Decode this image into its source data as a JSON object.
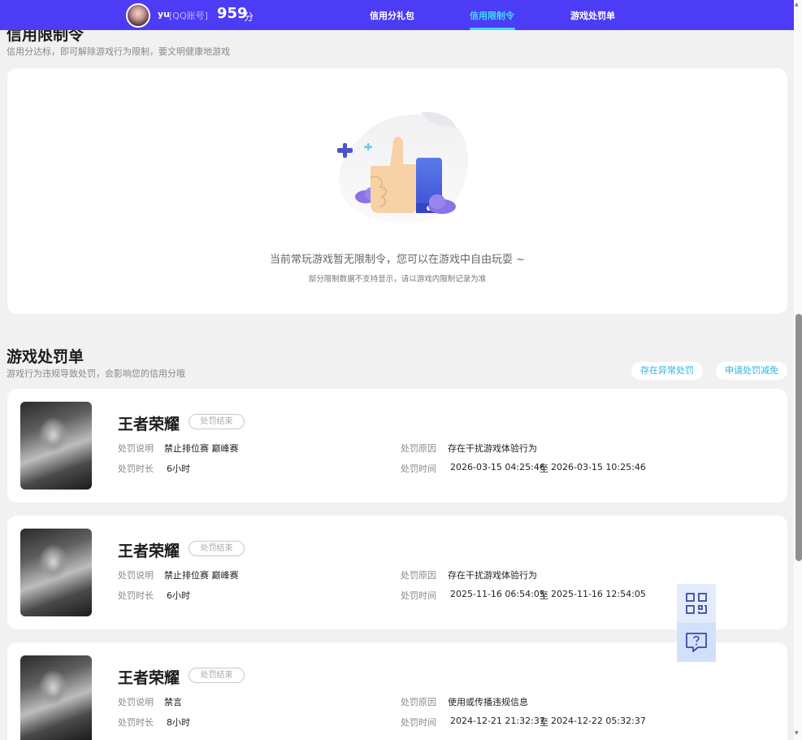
{
  "header": {
    "nickname": "yu",
    "account_type": "[QQ账号]",
    "score": "959",
    "score_unit": "分",
    "nav": [
      {
        "label": "信用分礼包",
        "active": false
      },
      {
        "label": "信用限制令",
        "active": true
      },
      {
        "label": "游戏处罚单",
        "active": false
      }
    ],
    "active_color": "#42d7ff",
    "bar_color": "#4c3cf5"
  },
  "restriction": {
    "title": "信用限制令",
    "desc": "信用分达标，即可解除游戏行为限制，要文明健康地游戏",
    "empty_main": "当前常玩游戏暂无限制令，您可以在游戏中自由玩耍 ~",
    "empty_sub": "部分限制数据不支持显示，请以游戏内限制记录为准",
    "illustration_icon": "thumbs-up-icon"
  },
  "penalty": {
    "title": "游戏处罚单",
    "desc": "游戏行为违规导致处罚，会影响您的信用分哦",
    "btn_abnormal": "存在异常处罚",
    "btn_appeal": "申请处罚减免",
    "labels": {
      "desc": "处罚说明",
      "duration": "处罚时长",
      "reason": "处罚原因",
      "time": "处罚时间"
    },
    "time_sep": "至",
    "items": [
      {
        "game": "王者荣耀",
        "status": "处罚结束",
        "desc": "禁止排位赛 巅峰赛",
        "duration": "6小时",
        "reason": "存在干扰游戏体验行为",
        "time_start": "2026-03-15 04:25:46",
        "time_end": "2026-03-15 10:25:46"
      },
      {
        "game": "王者荣耀",
        "status": "处罚结束",
        "desc": "禁止排位赛 巅峰赛",
        "duration": "6小时",
        "reason": "存在干扰游戏体验行为",
        "time_start": "2025-11-16 06:54:05",
        "time_end": "2025-11-16 12:54:05"
      },
      {
        "game": "王者荣耀",
        "status": "处罚结束",
        "desc": "禁言",
        "duration": "8小时",
        "reason": "使用或传播违规信息",
        "time_start": "2024-12-21 21:32:37",
        "time_end": "2024-12-22 05:32:37"
      }
    ]
  },
  "floating": {
    "qr_icon": "qr-code-icon",
    "help_icon": "help-chat-icon"
  }
}
